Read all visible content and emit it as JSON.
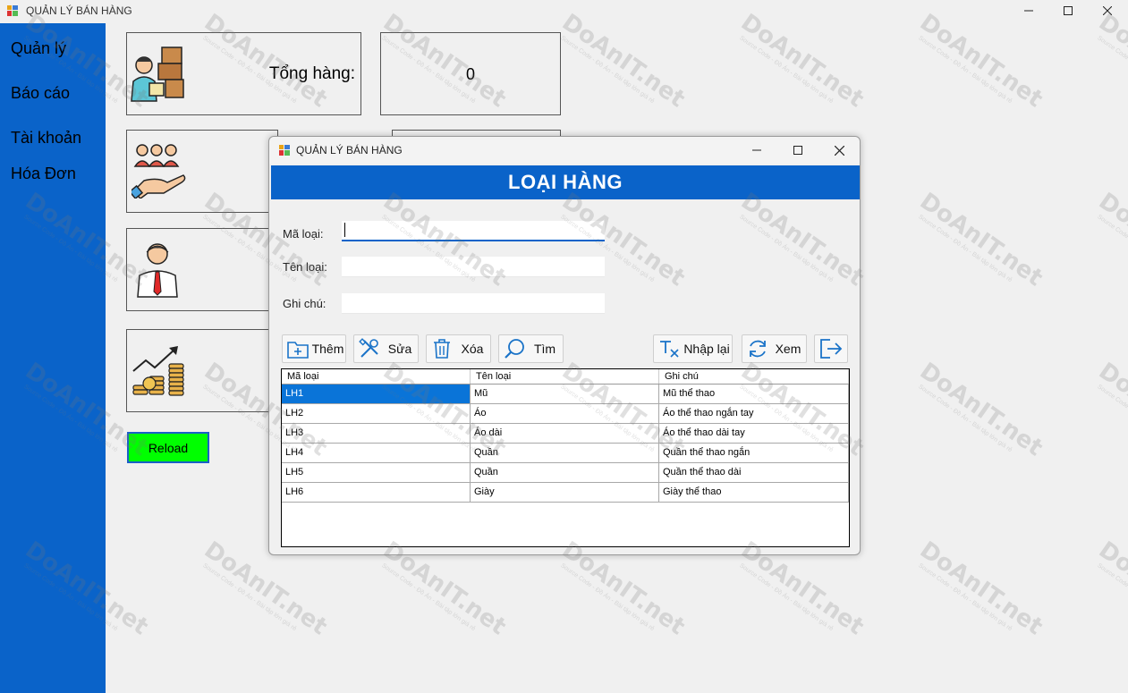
{
  "window": {
    "title": "QUẢN LÝ BÁN HÀNG"
  },
  "sidebar": {
    "items": [
      {
        "label": "Quản lý"
      },
      {
        "label": "Báo cáo"
      },
      {
        "label": "Tài khoản"
      },
      {
        "label": "Hóa Đơn"
      }
    ]
  },
  "dashboard": {
    "total_label": "Tổng hàng:",
    "total_value": "0",
    "reload_label": "Reload"
  },
  "dialog": {
    "title": "QUẢN LÝ BÁN HÀNG",
    "header": "LOẠI HÀNG",
    "fields": {
      "ma_loai_label": "Mã loại:",
      "ma_loai_value": "",
      "ten_loai_label": "Tên loại:",
      "ten_loai_value": "",
      "ghi_chu_label": "Ghi chú:",
      "ghi_chu_value": ""
    },
    "buttons": {
      "them": "Thêm",
      "sua": "Sửa",
      "xoa": "Xóa",
      "tim": "Tìm",
      "nhap_lai": "Nhập lại",
      "xem": "Xem"
    },
    "grid": {
      "columns": [
        "Mã loại",
        "Tên loại",
        "Ghi chú"
      ],
      "rows": [
        [
          "LH1",
          "Mũ",
          "Mũ thể thao"
        ],
        [
          "LH2",
          "Áo",
          "Áo thể thao ngắn tay"
        ],
        [
          "LH3",
          "Áo dài",
          "Áo thể thao dài tay"
        ],
        [
          "LH4",
          "Quần",
          "Quần thể thao ngắn"
        ],
        [
          "LH5",
          "Quần",
          "Quần thể thao dài"
        ],
        [
          "LH6",
          "Giày",
          "Giày thể thao"
        ]
      ],
      "selected_row": 0
    }
  },
  "watermark": {
    "text": "DoAnIT.net",
    "sub": "Source Code - Đồ Án - Bài tập lớn giá rẻ"
  },
  "colors": {
    "sidebar": "#0a63c9",
    "header": "#0a63c9",
    "reload": "#00ff00",
    "selection": "#0a74d8"
  }
}
